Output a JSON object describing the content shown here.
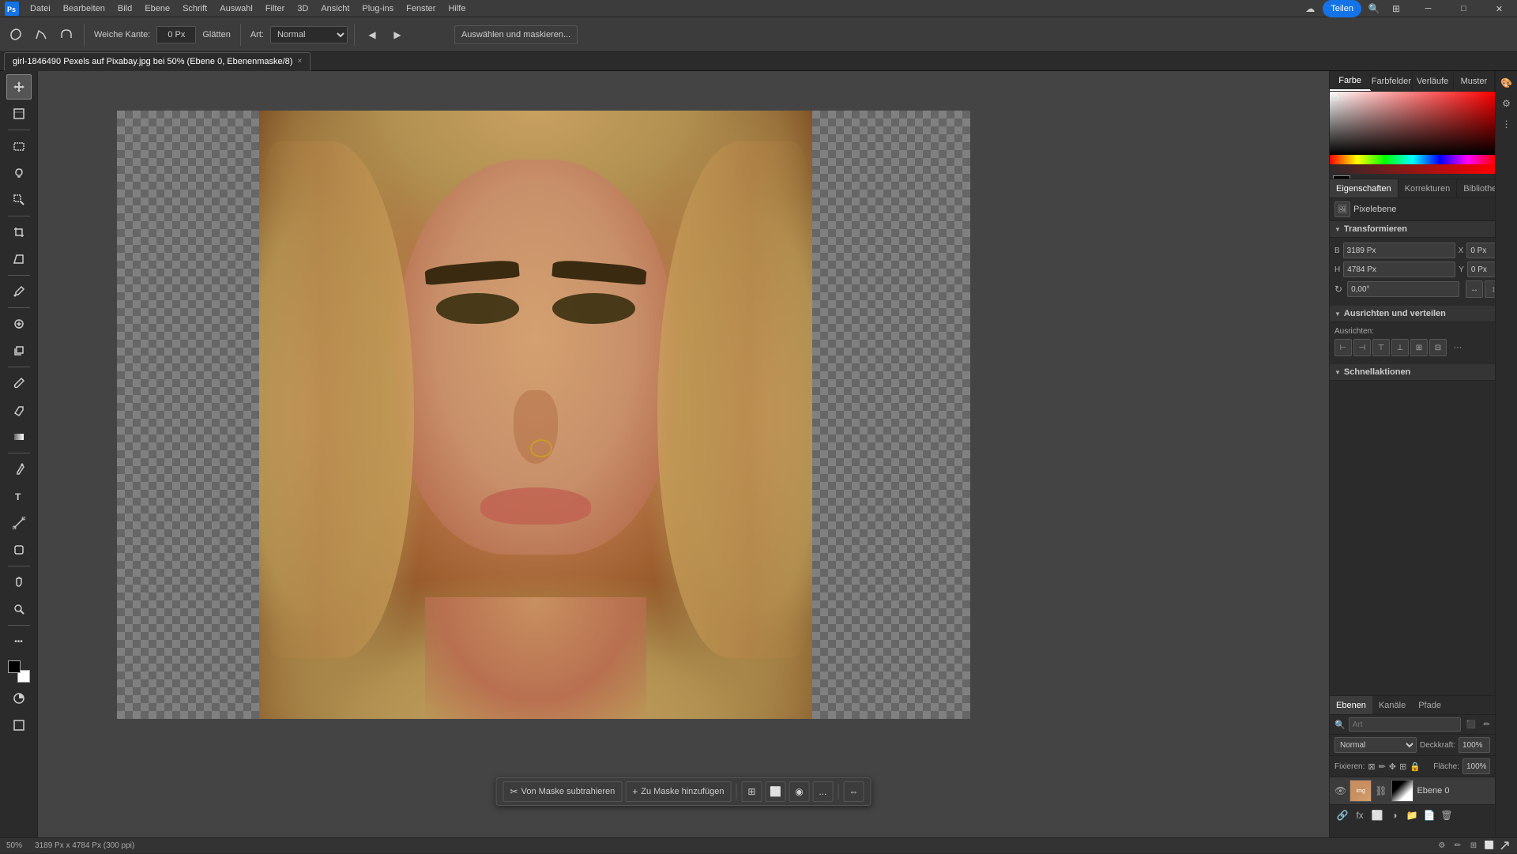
{
  "app": {
    "title": "Adobe Photoshop",
    "window_title": "girl-1846490 Pexels auf Pixabay.jpg bei 50% (Ebene 0, Ebenenmaske/8)"
  },
  "menubar": {
    "items": [
      "Datei",
      "Bearbeiten",
      "Bild",
      "Ebene",
      "Schrift",
      "Auswahl",
      "Filter",
      "3D",
      "Ansicht",
      "Plug-ins",
      "Fenster",
      "Hilfe"
    ]
  },
  "toolbar": {
    "weiche_kante_label": "Weiche Kante:",
    "weiche_kante_value": "0 Px",
    "glatt_label": "Glätten",
    "art_label": "Art:",
    "art_value": "Normal",
    "select_mask_btn": "Auswählen und maskieren...",
    "share_btn": "Teilen"
  },
  "tab": {
    "filename": "girl-1846490 Pexels auf Pixabay.jpg bei 50% (Ebene 0, Ebenenmaske/8)",
    "close": "×"
  },
  "color_panel": {
    "tabs": [
      "Farbe",
      "Farbfelder",
      "Verläufe",
      "Muster"
    ]
  },
  "properties_panel": {
    "tabs": [
      "Eigenschaften",
      "Korrekturen",
      "Bibliotheken"
    ],
    "layer_types": [
      "Pixelebene"
    ],
    "transform_section": "Transformieren",
    "w_label": "B",
    "h_label": "H",
    "w_value": "3189 Px",
    "h_value": "4784 Px",
    "x_value": "0 Px",
    "y_value": "0 Px",
    "angle_value": "0,00°",
    "align_section": "Ausrichten und verteilen",
    "align_label": "Ausrichten:",
    "quick_section": "Schnellaktionen"
  },
  "layers_panel": {
    "tabs": [
      "Ebenen",
      "Kanäle",
      "Pfade"
    ],
    "search_placeholder": "Art",
    "blend_mode": "Normal",
    "opacity_label": "Deckkraft:",
    "opacity_value": "100%",
    "fill_label": "Fläche:",
    "fill_value": "100%",
    "lock_label": "Fixieren:",
    "layer_name": "Ebene 0",
    "layer_type": "Normal"
  },
  "floating_toolbar": {
    "subtract_btn": "Von Maske subtrahieren",
    "add_btn": "Zu Maske hinzufügen",
    "more": "..."
  },
  "statusbar": {
    "zoom": "50%",
    "dimensions": "3189 Px x 4784 Px (300 ppi)"
  }
}
